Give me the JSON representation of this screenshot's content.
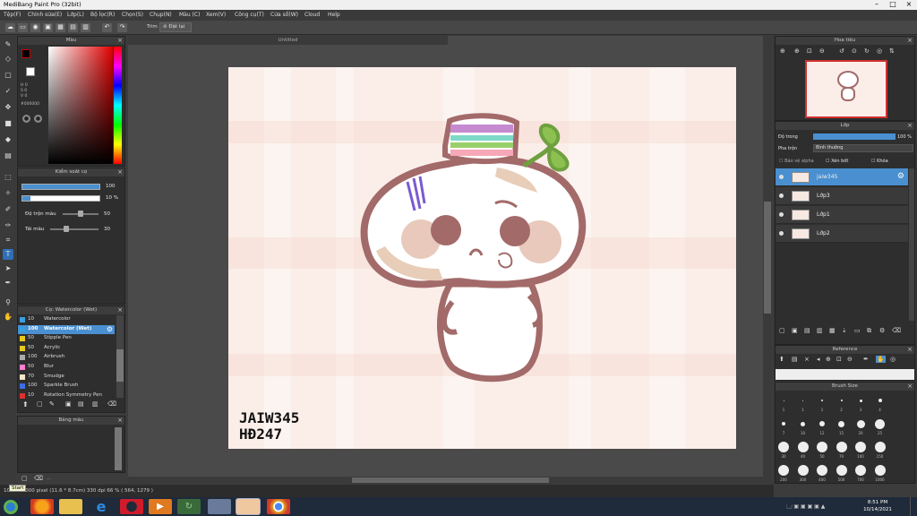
{
  "window": {
    "title": "MediBang Paint Pro (32bit)"
  },
  "menu": [
    "Tệp(F)",
    "Chỉnh sửa(E)",
    "Lớp(L)",
    "Bộ lọc(R)",
    "Chọn(S)",
    "Chụp(N)",
    "Màu (C)",
    "Xem(V)",
    "Công cụ(T)",
    "Cửa sổ(W)",
    "Cloud",
    "Help"
  ],
  "toolbar": {
    "trim_label": "Trim",
    "reset_label": "Đặt lại"
  },
  "document": {
    "tab_title": "Untitled"
  },
  "color_panel": {
    "title": "Màu",
    "values": [
      "H 0",
      "S 0",
      "V 0"
    ],
    "hex": "#000000",
    "primary_color": "#000000"
  },
  "brush_control": {
    "title": "Kiểm soát cọ",
    "size_value": "100",
    "opacity_value": "10 %",
    "blend_label": "Độ trộn màu",
    "blend_value": "50",
    "refill_label": "Tái màu",
    "refill_value": "30"
  },
  "brush_list": {
    "title": "Cọ: Watercolor (Wet)",
    "items": [
      {
        "size": "10",
        "name": "Watercolor",
        "color": "#39a0e0"
      },
      {
        "size": "100",
        "name": "Watercolor (Wet)",
        "color": "#39a0e0",
        "selected": true
      },
      {
        "size": "50",
        "name": "Stipple Pen",
        "color": "#e8c81a"
      },
      {
        "size": "50",
        "name": "Acrylic",
        "color": "#e8c81a"
      },
      {
        "size": "100",
        "name": "Airbrush",
        "color": "#aaaaaa"
      },
      {
        "size": "50",
        "name": "Blur",
        "color": "#ff7fd0"
      },
      {
        "size": "70",
        "name": "Smudge",
        "color": "#f5e6c8"
      },
      {
        "size": "100",
        "name": "Sparkle Brush",
        "color": "#3b6ee8"
      },
      {
        "size": "10",
        "name": "Rotation Symmetry Pen",
        "color": "#e03030"
      }
    ]
  },
  "tone_panel": {
    "title": "Bảng màu"
  },
  "navigator": {
    "title": "Hoa tiêu"
  },
  "layers_panel": {
    "title": "Lớp",
    "opacity_label": "Độ trong",
    "opacity_value": "100 %",
    "blend_label": "Pha trộn",
    "blend_value": "Bình thường",
    "options": [
      "Bảo vệ alpha",
      "Xén bớt",
      "Khóa"
    ],
    "layers": [
      {
        "name": "jaiw345",
        "selected": true
      },
      {
        "name": "Lớp3"
      },
      {
        "name": "Lớp1"
      },
      {
        "name": "Lớp2"
      }
    ]
  },
  "reference_panel": {
    "title": "Reference"
  },
  "brush_size_panel": {
    "title": "Brush Size",
    "rows": [
      [
        "1",
        "1",
        "1",
        "2",
        "3",
        "4"
      ],
      [
        "7",
        "10",
        "12",
        "15",
        "20",
        "25"
      ],
      [
        "30",
        "40",
        "50",
        "70",
        "100",
        "150"
      ],
      [
        "200",
        "300",
        "400",
        "500",
        "700",
        "1000"
      ]
    ]
  },
  "canvas_text": {
    "line1": "JAIW345",
    "line2": "HĐ247"
  },
  "status": {
    "info": "1000 x 1000 pixel  (11.6 * 8.7cm)  330 dpi  66 %  ( 564, 1279 )",
    "tooltip": "Start"
  },
  "taskbar": {
    "time": "8:51 PM",
    "date": "10/14/2021"
  }
}
